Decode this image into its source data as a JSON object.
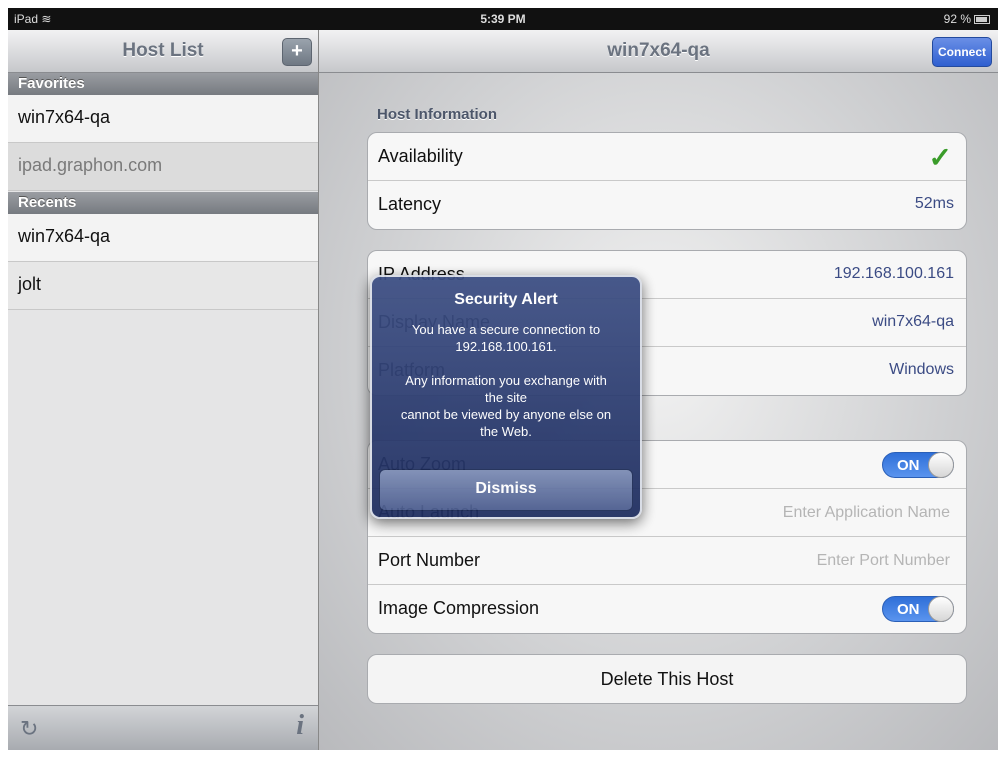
{
  "status_bar": {
    "carrier": "iPad",
    "wifi_icon": "wifi-icon",
    "time": "5:39 PM",
    "battery": "92 %"
  },
  "left_pane": {
    "title": "Host List",
    "add_label": "+",
    "sections": [
      {
        "header": "Favorites",
        "items": [
          "win7x64-qa",
          "ipad.graphon.com"
        ]
      },
      {
        "header": "Recents",
        "items": [
          "win7x64-qa",
          "jolt"
        ]
      }
    ],
    "toolbar": {
      "refresh_icon": "refresh-icon",
      "info_icon": "info-icon"
    }
  },
  "right_pane": {
    "title": "win7x64-qa",
    "connect_label": "Connect",
    "host_info_label": "Host Information",
    "group1": [
      {
        "key": "Availability",
        "value": "✓"
      },
      {
        "key": "Latency",
        "value": "52ms"
      }
    ],
    "group2": [
      {
        "key": "IP Address",
        "value": "192.168.100.161"
      },
      {
        "key": "Display Name",
        "value": "win7x64-qa"
      },
      {
        "key": "Platform",
        "value": "Windows"
      }
    ],
    "group3": [
      {
        "key": "Auto Zoom",
        "toggle": "ON"
      },
      {
        "key": "Auto Launch",
        "placeholder": "Enter Application Name"
      },
      {
        "key": "Port Number",
        "placeholder": "Enter Port Number"
      },
      {
        "key": "Image Compression",
        "toggle": "ON"
      }
    ],
    "delete_label": "Delete This Host"
  },
  "alert": {
    "title": "Security Alert",
    "message": "You have a secure connection to\n192.168.100.161.\n\nAny information you exchange with\nthe site\ncannot be viewed by anyone else on\nthe Web.",
    "button": "Dismiss"
  },
  "colors": {
    "accent": "#2f5fd0",
    "alert_bg": "#2b3b6e",
    "check": "#3a9c2a"
  }
}
